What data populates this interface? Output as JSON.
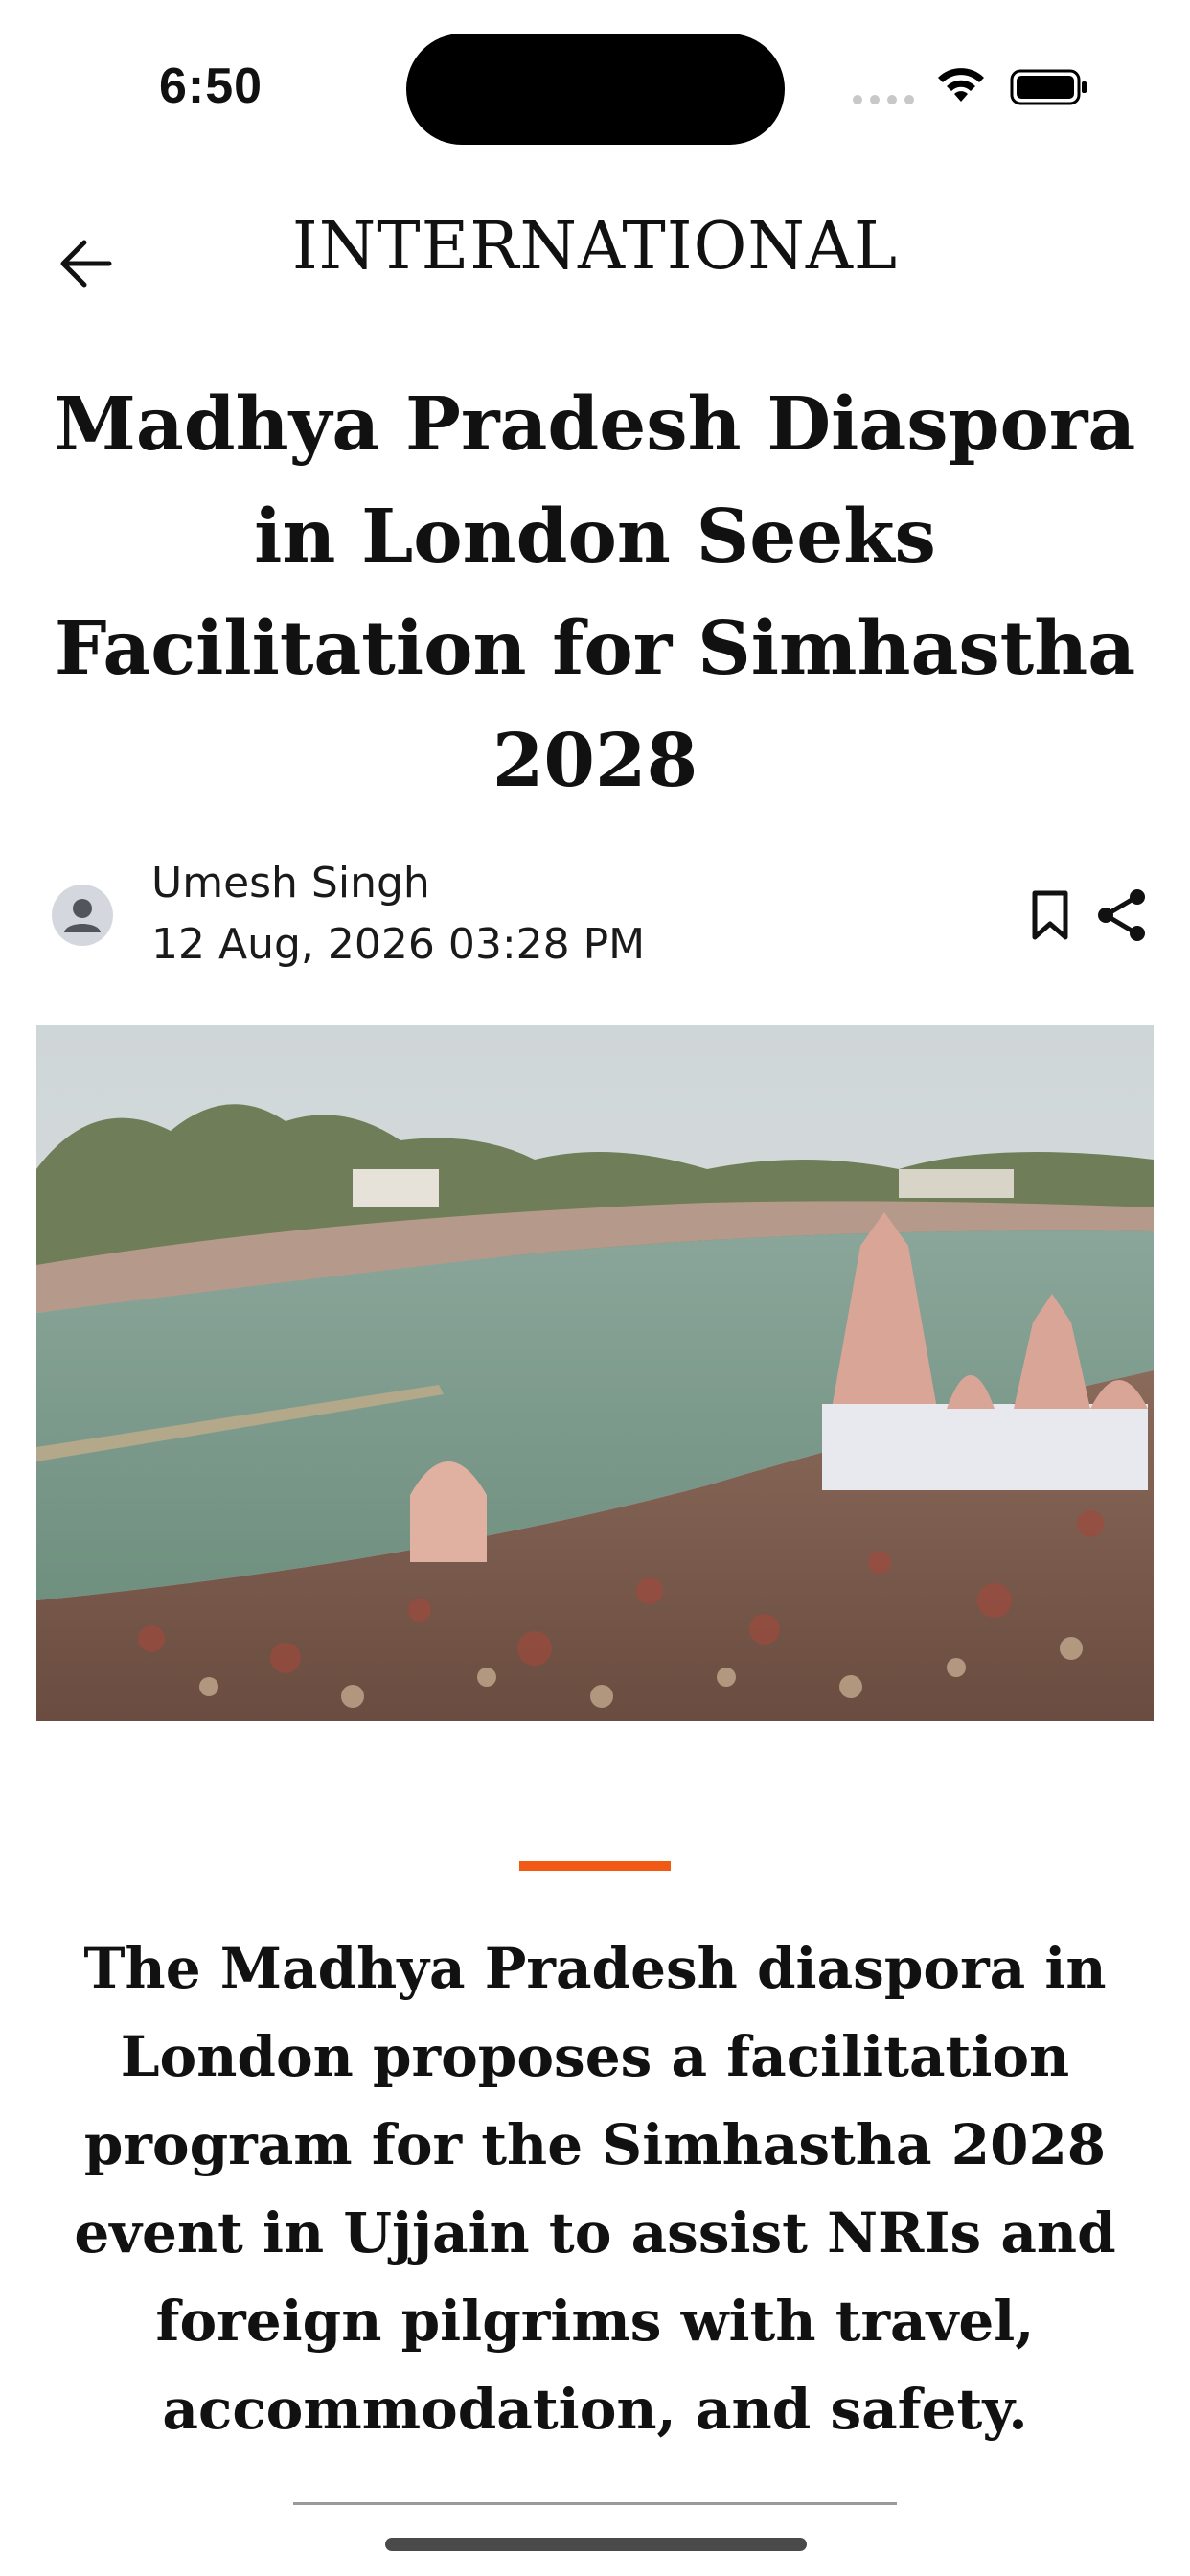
{
  "status_bar": {
    "time": "6:50"
  },
  "header": {
    "section": "INTERNATIONAL",
    "icons": {
      "back": "arrow-left-icon"
    }
  },
  "article": {
    "headline": "Madhya Pradesh Diaspora in London Seeks Facilitation for Simhastha 2028",
    "author": "Umesh Singh",
    "published": "12 Aug, 2026 03:28 PM",
    "summary": "The Madhya Pradesh diaspora in London proposes a facilitation program for the Simhastha 2028 event in Ujjain to assist NRIs and foreign pilgrims with travel, accommodation, and safety.",
    "actions": {
      "bookmark_icon": "bookmark-icon",
      "share_icon": "share-icon"
    }
  },
  "colors": {
    "accent": "#f05a14",
    "text": "#111111",
    "background": "#ffffff"
  }
}
